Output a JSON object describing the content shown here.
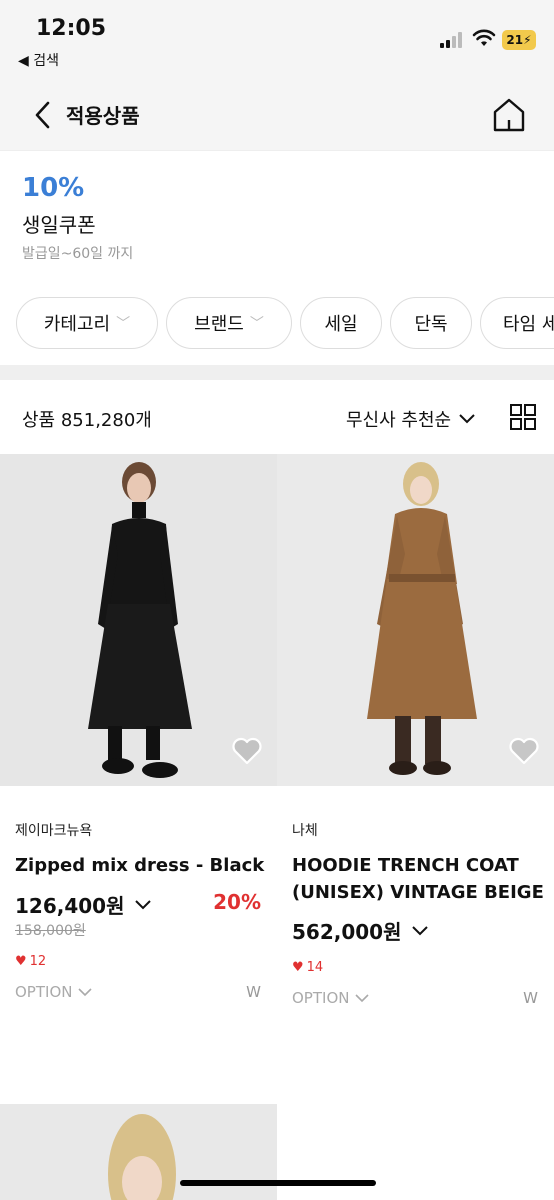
{
  "status_bar": {
    "time": "12:05",
    "back_app": "◀ 검색",
    "battery": "21"
  },
  "header": {
    "title": "적용상품"
  },
  "coupon": {
    "percent": "10%",
    "name": "생일쿠폰",
    "period": "발급일~60일 까지"
  },
  "filters": [
    {
      "label": "카테고리",
      "has_dropdown": true
    },
    {
      "label": "브랜드",
      "has_dropdown": true
    },
    {
      "label": "세일",
      "has_dropdown": false
    },
    {
      "label": "단독",
      "has_dropdown": false
    },
    {
      "label": "타임 세",
      "has_dropdown": false
    }
  ],
  "toolbar": {
    "count": "상품 851,280개",
    "sort": "무신사 추천순"
  },
  "products": [
    {
      "brand": "제이마크뉴욕",
      "name": "Zipped mix dress - Black",
      "price": "126,400원",
      "discount": "20%",
      "original_price": "158,000원",
      "likes": "12",
      "option": "OPTION",
      "gender": "W"
    },
    {
      "brand": "나체",
      "name": "HOODIE TRENCH COAT (UNISEX) VINTAGE BEIGE",
      "price": "562,000원",
      "likes": "14",
      "option": "OPTION",
      "gender": "W"
    }
  ],
  "colors": {
    "accent_blue": "#3b7fd6",
    "sale_red": "#e03131"
  }
}
